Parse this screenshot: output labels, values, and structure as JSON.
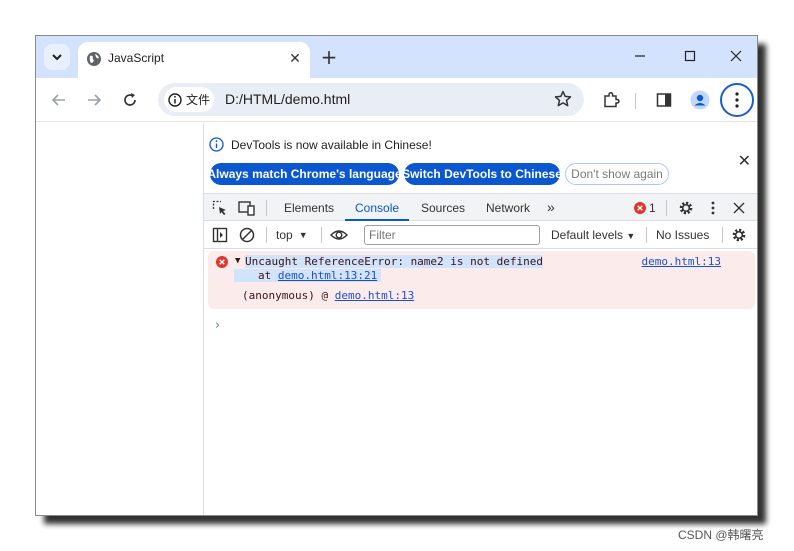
{
  "tab": {
    "title": "JavaScript"
  },
  "address": {
    "chip_label": "文件",
    "url": "D:/HTML/demo.html"
  },
  "infobar": {
    "message": "DevTools is now available in Chinese!",
    "btn_match": "Always match Chrome's language",
    "btn_switch": "Switch DevTools to Chinese",
    "btn_dismiss": "Don't show again"
  },
  "devtools_tabs": [
    "Elements",
    "Console",
    "Sources",
    "Network"
  ],
  "error_count": "1",
  "console_toolbar": {
    "context": "top",
    "filter_placeholder": "Filter",
    "levels": "Default levels",
    "issues": "No Issues"
  },
  "error": {
    "message": "Uncaught ReferenceError: name2 is not defined",
    "at_prefix": "at",
    "at_link": "demo.html:13:21",
    "anon_prefix": "(anonymous) @",
    "anon_link": "demo.html:13",
    "source_link": "demo.html:13"
  },
  "watermark": "CSDN @韩曙亮",
  "colors": {
    "accent": "#0b57d0",
    "tab_strip": "#d3e3fd",
    "error_bg": "#fcebeb",
    "error_icon": "#dc362e"
  }
}
